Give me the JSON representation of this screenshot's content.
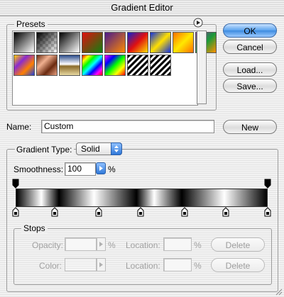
{
  "window": {
    "title": "Gradient Editor"
  },
  "presets": {
    "label": "Presets",
    "menu_icon": "circle-arrow-right-icon",
    "swatches": [
      {
        "name": "foreground-to-background",
        "css": "linear-gradient(135deg,#000,#fff)"
      },
      {
        "name": "foreground-to-transparent",
        "css": "linear-gradient(135deg,#000,rgba(0,0,0,0))"
      },
      {
        "name": "black-white",
        "css": "linear-gradient(135deg,#000,#fff)"
      },
      {
        "name": "red-green",
        "css": "linear-gradient(135deg,#e01010,#108010)"
      },
      {
        "name": "violet-orange",
        "css": "linear-gradient(135deg,#4a1a8c,#ff8a00)"
      },
      {
        "name": "blue-red-yellow",
        "css": "linear-gradient(135deg,#1020d0,#e01010,#ffe000)"
      },
      {
        "name": "blue-yellow-blue",
        "css": "linear-gradient(135deg,#1030e0,#ffe000,#1030e0)"
      },
      {
        "name": "orange-yellow-orange",
        "css": "linear-gradient(135deg,#ff7000,#ffe800,#ff7000)"
      },
      {
        "name": "violet-green-orange",
        "css": "linear-gradient(135deg,#7a2aa0,#1a9a3a,#ff9000)"
      },
      {
        "name": "yellow-violet-orange-blue",
        "css": "linear-gradient(135deg,#ffd000,#8a2ad0,#ff8000,#2040e0)"
      },
      {
        "name": "copper",
        "css": "linear-gradient(135deg,#6a2a10,#f0b090,#6a2a10,#e8a080)"
      },
      {
        "name": "chrome",
        "css": "linear-gradient(180deg,#2a4a8a,#ffffff 45%,#8a6a2a 55%,#e8d8a0)"
      },
      {
        "name": "spectrum",
        "css": "linear-gradient(135deg,#ff0000,#ffff00,#00ff00,#00ffff,#0000ff,#ff00ff,#ff0000)"
      },
      {
        "name": "transparent-rainbow",
        "css": "linear-gradient(135deg,#ff00ff,#0000ff,#00ff00,#ffff00,#ff0000)"
      },
      {
        "name": "transparent-stripes",
        "css": "repeating-linear-gradient(135deg,#000 0px,#000 3px,#fff 3px,#fff 6px)"
      },
      {
        "name": "black-white-stripes",
        "css": "repeating-linear-gradient(135deg,#000 0px,#000 3px,#fff 3px,#fff 6px)"
      }
    ]
  },
  "buttons": {
    "ok": "OK",
    "cancel": "Cancel",
    "load": "Load...",
    "save": "Save...",
    "new": "New"
  },
  "name": {
    "label": "Name:",
    "value": "Custom"
  },
  "gradient_type": {
    "group_label": "",
    "label": "Gradient Type:",
    "value": "Solid"
  },
  "smoothness": {
    "label": "Smoothness:",
    "value": "100",
    "unit": "%"
  },
  "gradient_bar": {
    "css": "linear-gradient(90deg,#000 0%,#fff 10%,#000 17%,#fff 31%,#000 48%,#fff 55%,#000 66%,#fff 83%,#000 100%)",
    "opacity_stop_icon": "opacity-stop-icon",
    "color_stop_icon": "color-stop-icon"
  },
  "stops": {
    "label": "Stops",
    "opacity_label": "Opacity:",
    "opacity_value": "",
    "opacity_unit": "%",
    "color_label": "Color:",
    "location_label": "Location:",
    "location_unit": "%",
    "location_value_1": "",
    "location_value_2": "",
    "delete_label": "Delete"
  }
}
